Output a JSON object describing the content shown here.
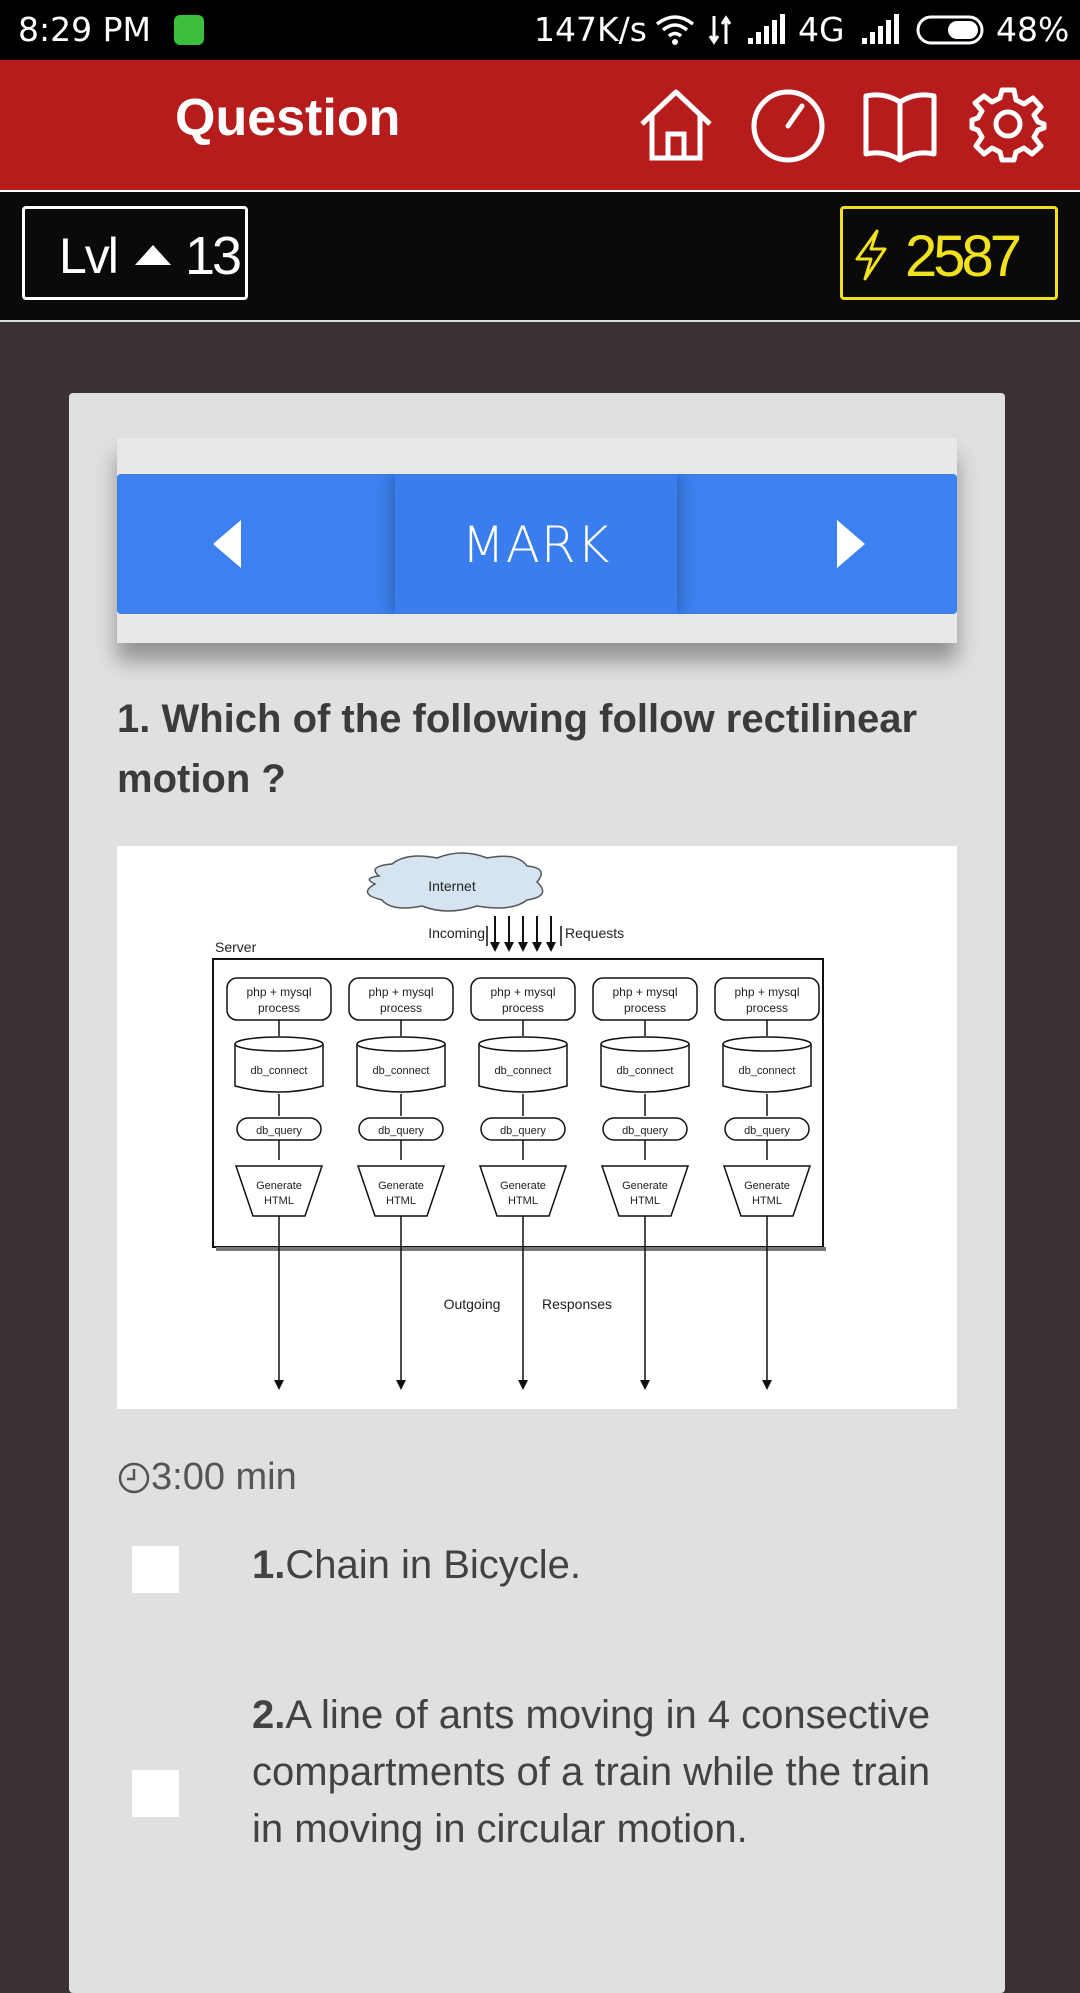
{
  "status_bar": {
    "time": "8:29 PM",
    "speed": "147K/s",
    "network": "4G",
    "battery": "48%"
  },
  "app_bar": {
    "title": "Question",
    "icons": [
      "home-icon",
      "timer-icon",
      "book-icon",
      "settings-icon"
    ]
  },
  "level_bar": {
    "level_label": "Lvl",
    "level": "13",
    "score": "2587"
  },
  "mark_bar": {
    "label": "MARK"
  },
  "question": {
    "text": "1. Which of the following follow rectilinear motion ?"
  },
  "diagram": {
    "cloud": "Internet",
    "incoming": "Incoming",
    "requests": "Requests",
    "server": "Server",
    "process": [
      "php + mysql",
      "process"
    ],
    "db_connect": "db_connect",
    "db_query": "db_query",
    "generate": [
      "Generate",
      "HTML"
    ],
    "outgoing": "Outgoing",
    "responses": "Responses"
  },
  "timer": {
    "value": "3:00 min"
  },
  "options": [
    {
      "num": "1.",
      "text": "Chain in Bicycle."
    },
    {
      "num": "2.",
      "text": "A line of ants moving in 4 consective compartments of a train while the train in moving in circular motion."
    }
  ],
  "colors": {
    "app_bar": "#b71c1c",
    "mark_bar": "#3d80f0",
    "score": "#f2e21d",
    "background": "#3a3232"
  }
}
